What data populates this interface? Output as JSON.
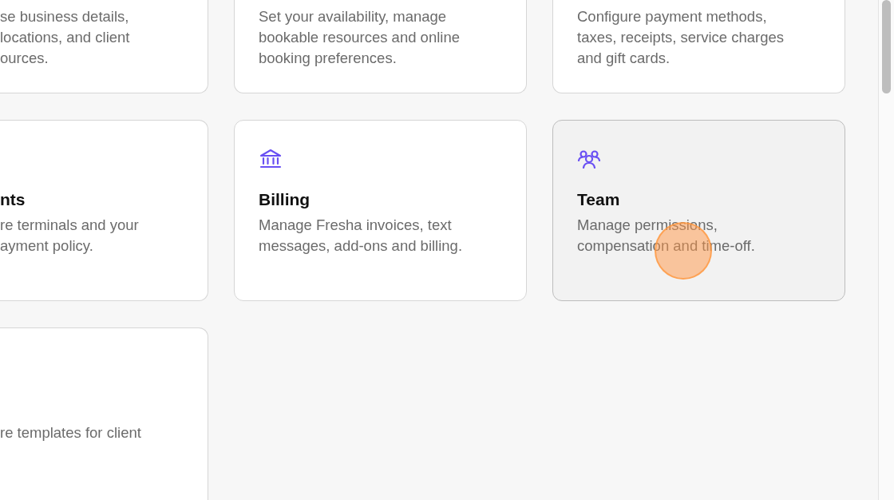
{
  "cards": [
    {
      "cut_left": true,
      "hovered": false,
      "description_lines": [
        "se business details,",
        "locations, and client",
        "ources."
      ]
    },
    {
      "cut_left": false,
      "hovered": false,
      "description_lines": [
        "Set your availability, manage",
        "bookable resources and online",
        "booking preferences."
      ]
    },
    {
      "cut_left": false,
      "hovered": false,
      "description_lines": [
        "Configure payment methods,",
        "taxes, receipts, service charges",
        "and gift cards."
      ]
    },
    {
      "kind": "plain",
      "cut_left": true,
      "hovered": false,
      "title": "nts",
      "description_lines": [
        "re terminals and your",
        "ayment policy."
      ]
    },
    {
      "kind": "billing",
      "cut_left": false,
      "hovered": false,
      "title": "Billing",
      "description_lines": [
        "Manage Fresha invoices, text",
        "messages, add-ons and billing."
      ]
    },
    {
      "kind": "team",
      "cut_left": false,
      "hovered": true,
      "title": "Team",
      "description_lines": [
        "Manage permissions,",
        "compensation and time-off."
      ]
    },
    {
      "kind": "plain",
      "cut_left": true,
      "hovered": false,
      "description_lines": [
        "re templates for client"
      ]
    }
  ]
}
